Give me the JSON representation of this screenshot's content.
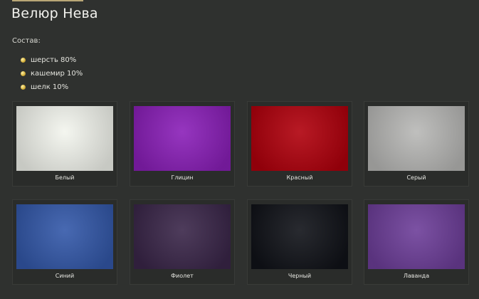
{
  "title": "Велюр Нева",
  "composition": {
    "label": "Состав:",
    "items": [
      "шерсть 80%",
      "кашемир 10%",
      "шелк 10%"
    ]
  },
  "swatches": [
    {
      "name": "Белый",
      "color": "#f3f5ee"
    },
    {
      "name": "Глицин",
      "color": "#8a1fb8"
    },
    {
      "name": "Красный",
      "color": "#b0000c"
    },
    {
      "name": "Серый",
      "color": "#b8b8b6"
    },
    {
      "name": "Синий",
      "color": "#3358a9"
    },
    {
      "name": "Фиолет",
      "color": "#3a2649"
    },
    {
      "name": "Черный",
      "color": "#101218"
    },
    {
      "name": "Лаванда",
      "color": "#6d3e99"
    }
  ]
}
